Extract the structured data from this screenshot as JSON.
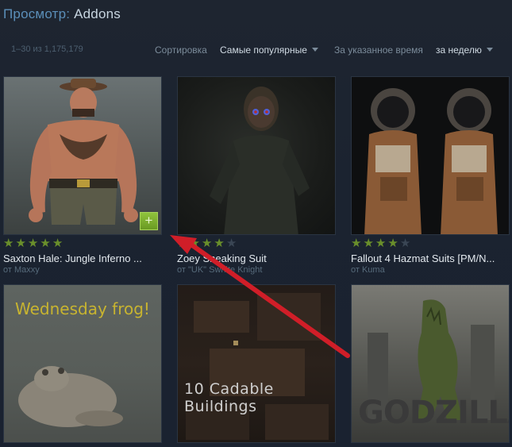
{
  "header": {
    "prefix": "Просмотр:",
    "current": "Addons"
  },
  "filters": {
    "count": "1–30 из 1,175,179",
    "sort_label": "Сортировка",
    "sort_value": "Самые популярные",
    "time_label": "За указанное время",
    "time_value": "за неделю"
  },
  "items": [
    {
      "title": "Saxton Hale: Jungle Inferno ...",
      "author": "от Maxxy",
      "rating": 5,
      "thumb_text": ""
    },
    {
      "title": "Zoey Sneaking Suit",
      "author": "от \"UK\" Swhite Knight",
      "rating": 4,
      "thumb_text": ""
    },
    {
      "title": "Fallout 4 Hazmat Suits [PM/N...",
      "author": "от Kuma",
      "rating": 4,
      "thumb_text": ""
    },
    {
      "title": "",
      "author": "",
      "rating": 0,
      "thumb_text": "Wednesday frog!"
    },
    {
      "title": "",
      "author": "",
      "rating": 0,
      "thumb_text": "10 Cadable Buildings"
    },
    {
      "title": "",
      "author": "",
      "rating": 0,
      "thumb_text": "GODZILLA"
    }
  ],
  "add_button_symbol": "+",
  "colors": {
    "accent": "#5b8fb9",
    "star_on": "#6a8f2b",
    "star_off": "#3a4654",
    "arrow": "#d01e28",
    "add_button": "#7fb236"
  }
}
